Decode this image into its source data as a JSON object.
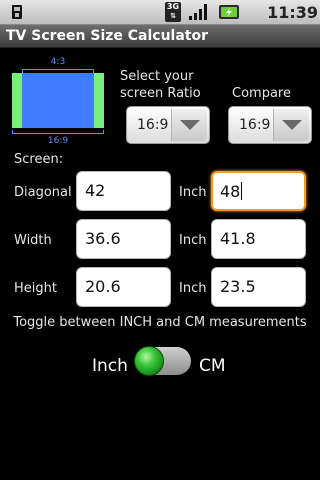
{
  "status_bar": {
    "network": "3G",
    "time": "11:39 PM",
    "icons": [
      "usb-icon",
      "network-3g-icon",
      "signal-icon",
      "battery-charging-icon"
    ]
  },
  "app": {
    "title": "TV Screen Size Calculator"
  },
  "ratio_preview": {
    "top_label": "4:3",
    "bottom_label": "16:9",
    "colors": {
      "inner": "#3f7bff",
      "outer": "#7af07a",
      "guides": "#5a8cff"
    }
  },
  "selectors": {
    "ratio_label": "Select your\nscreen Ratio",
    "ratio_label_line1": "Select your",
    "ratio_label_line2": "screen Ratio",
    "compare_label": "Compare",
    "ratio_value": "16:9",
    "compare_value": "16:9"
  },
  "screen_section": {
    "label": "Screen:"
  },
  "rows": [
    {
      "label": "Diagonal",
      "value": "42",
      "unit": "Inch",
      "compare_value": "48"
    },
    {
      "label": "Width",
      "value": "36.6",
      "unit": "Inch",
      "compare_value": "41.8"
    },
    {
      "label": "Height",
      "value": "20.6",
      "unit": "Inch",
      "compare_value": "23.5"
    }
  ],
  "toggle": {
    "hint": "Toggle between INCH and CM measurements",
    "left_label": "Inch",
    "right_label": "CM",
    "state": "Inch",
    "accent": "#2fbf2f"
  }
}
